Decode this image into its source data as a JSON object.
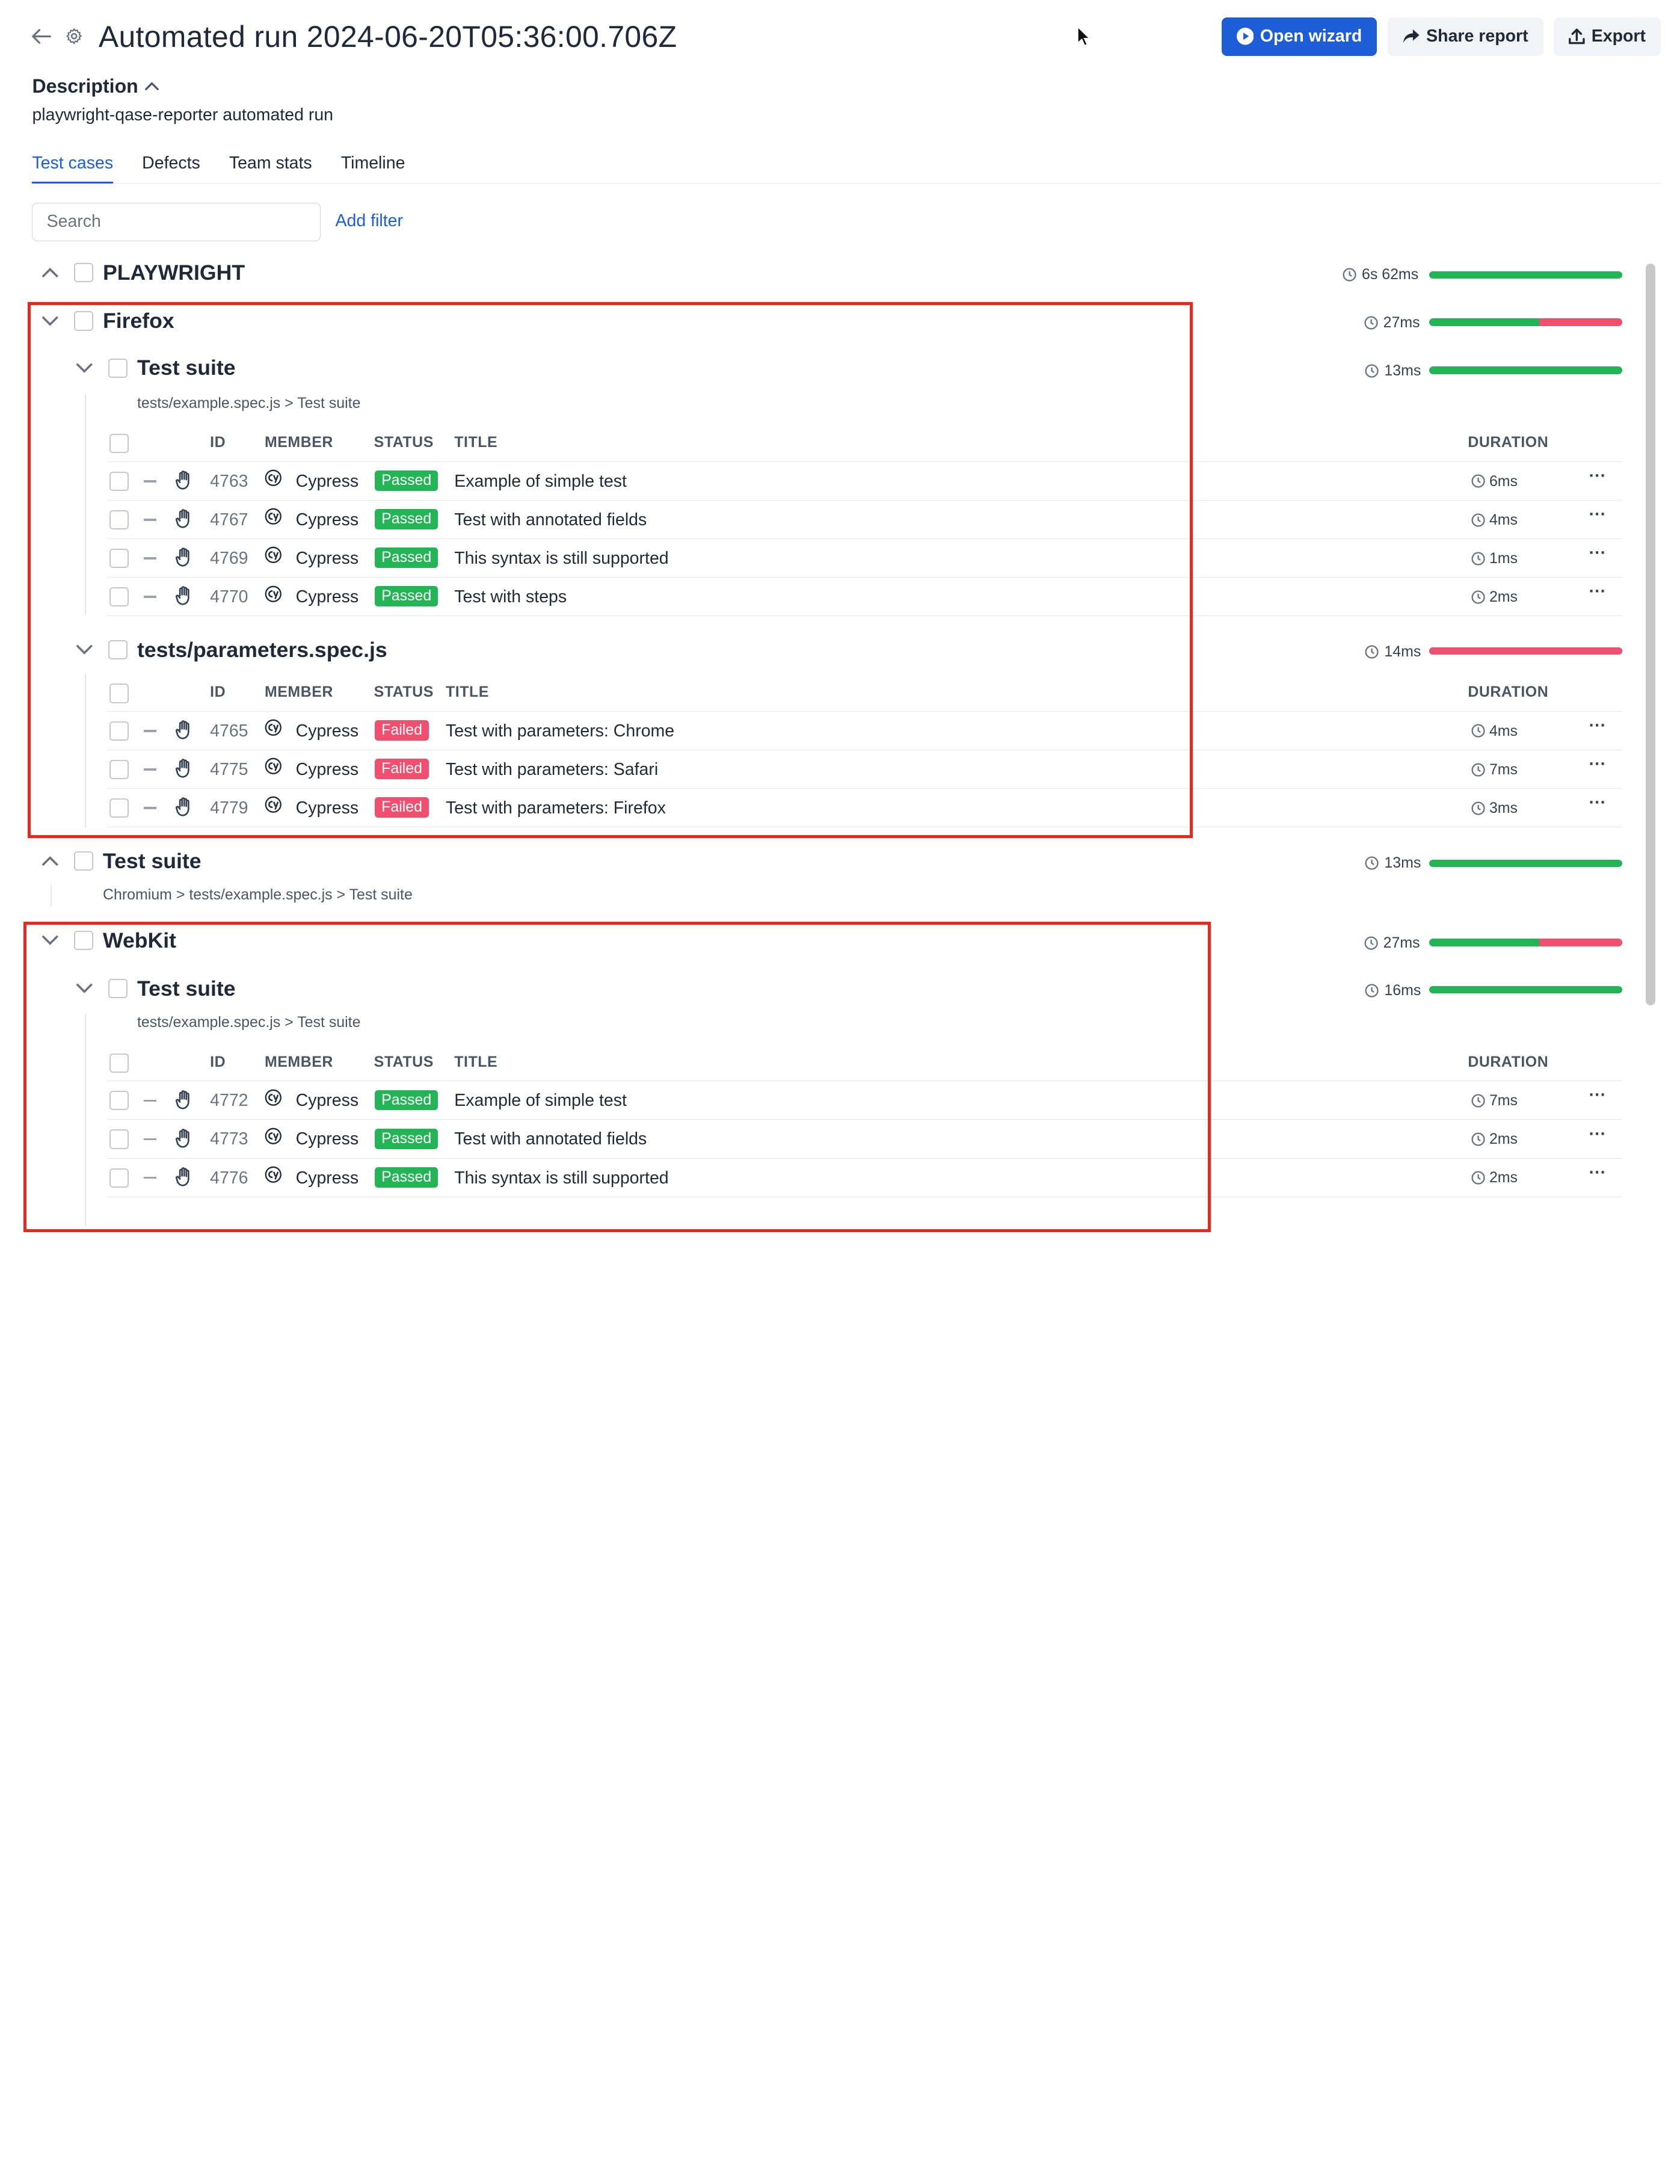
{
  "header": {
    "title": "Automated run 2024-06-20T05:36:00.706Z",
    "open_wizard": "Open wizard",
    "share_report": "Share report",
    "export": "Export"
  },
  "description": {
    "heading": "Description",
    "text": "playwright-qase-reporter automated run"
  },
  "tabs": [
    {
      "label": "Test cases",
      "active": true
    },
    {
      "label": "Defects"
    },
    {
      "label": "Team stats"
    },
    {
      "label": "Timeline"
    }
  ],
  "search": {
    "placeholder": "Search"
  },
  "add_filter": "Add filter",
  "table_headers": {
    "id": "ID",
    "member": "MEMBER",
    "status": "STATUS",
    "title": "TITLE",
    "duration": "DURATION"
  },
  "colors": {
    "accent": "#1d5ed8",
    "passed": "#22b455",
    "failed": "#f0506e",
    "highlight": "#e8291c"
  },
  "groups": {
    "playwright": {
      "name": "PLAYWRIGHT",
      "duration": "6s 62ms",
      "pass_fraction": 1.0
    },
    "firefox": {
      "name": "Firefox",
      "duration": "27ms",
      "pass_fraction": 0.57
    },
    "firefox_suite": {
      "name": "Test suite",
      "duration": "13ms",
      "pass_fraction": 1.0,
      "path": "tests/example.spec.js > Test suite"
    },
    "firefox_params": {
      "name": "tests/parameters.spec.js",
      "duration": "14ms",
      "pass_fraction": 0.0
    },
    "chromium_suite": {
      "name": "Test suite",
      "duration": "13ms",
      "pass_fraction": 1.0,
      "path": "Chromium > tests/example.spec.js > Test suite"
    },
    "webkit": {
      "name": "WebKit",
      "duration": "27ms",
      "pass_fraction": 0.57
    },
    "webkit_suite": {
      "name": "Test suite",
      "duration": "16ms",
      "pass_fraction": 1.0,
      "path": "tests/example.spec.js > Test suite"
    }
  },
  "firefox_suite_rows": [
    {
      "id": "4763",
      "member": "Cypress",
      "status": "Passed",
      "title": "Example of simple test",
      "duration": "6ms"
    },
    {
      "id": "4767",
      "member": "Cypress",
      "status": "Passed",
      "title": "Test with annotated fields",
      "duration": "4ms"
    },
    {
      "id": "4769",
      "member": "Cypress",
      "status": "Passed",
      "title": "This syntax is still supported",
      "duration": "1ms"
    },
    {
      "id": "4770",
      "member": "Cypress",
      "status": "Passed",
      "title": "Test with steps",
      "duration": "2ms"
    }
  ],
  "firefox_params_rows": [
    {
      "id": "4765",
      "member": "Cypress",
      "status": "Failed",
      "title": "Test with parameters: Chrome",
      "duration": "4ms"
    },
    {
      "id": "4775",
      "member": "Cypress",
      "status": "Failed",
      "title": "Test with parameters: Safari",
      "duration": "7ms"
    },
    {
      "id": "4779",
      "member": "Cypress",
      "status": "Failed",
      "title": "Test with parameters: Firefox",
      "duration": "3ms"
    }
  ],
  "webkit_suite_rows": [
    {
      "id": "4772",
      "member": "Cypress",
      "status": "Passed",
      "title": "Example of simple test",
      "duration": "7ms"
    },
    {
      "id": "4773",
      "member": "Cypress",
      "status": "Passed",
      "title": "Test with annotated fields",
      "duration": "2ms"
    },
    {
      "id": "4776",
      "member": "Cypress",
      "status": "Passed",
      "title": "This syntax is still supported",
      "duration": "2ms"
    }
  ]
}
